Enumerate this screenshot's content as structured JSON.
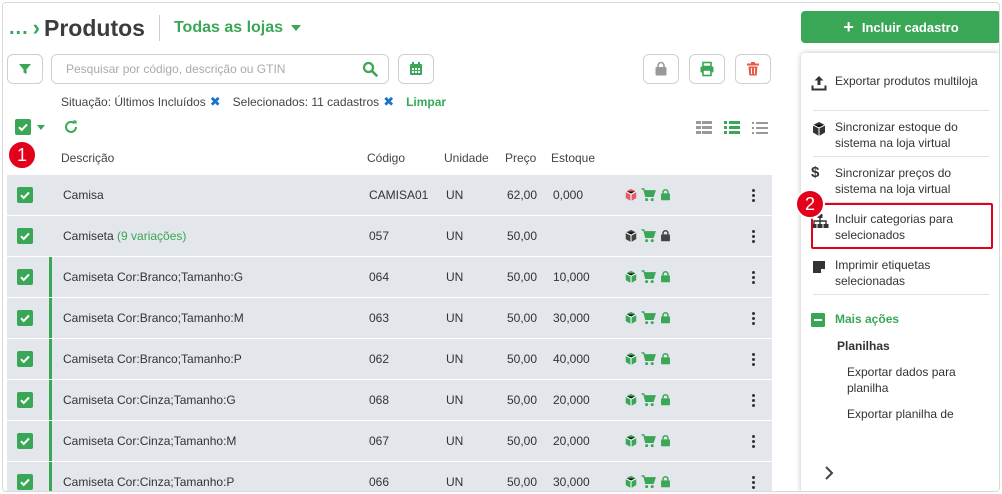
{
  "header": {
    "breadcrumb_dots": "...",
    "title": "Produtos",
    "store_selector": "Todas as lojas"
  },
  "actions": {
    "include_button": "Incluir cadastro"
  },
  "search": {
    "placeholder": "Pesquisar por código, descrição ou GTIN",
    "value": ""
  },
  "filters": {
    "situation": "Situação: Últimos Incluídos",
    "selected": "Selecionados: 11 cadastros",
    "clear": "Limpar"
  },
  "columns": {
    "description": "Descrição",
    "code": "Código",
    "unit": "Unidade",
    "price": "Preço",
    "stock": "Estoque"
  },
  "rows": [
    {
      "description": "Camisa",
      "variations": "",
      "code": "CAMISA01",
      "unit": "UN",
      "price": "62,00",
      "stock": "0,000",
      "type": "parent",
      "box_color": "#e35d6a",
      "bag_color": "#3aa757"
    },
    {
      "description": "Camiseta",
      "variations": "(9 variações)",
      "code": "057",
      "unit": "UN",
      "price": "50,00",
      "stock": "",
      "type": "parent",
      "box_color": "#444444",
      "bag_color": "#444444"
    },
    {
      "description": "Camiseta Cor:Branco;Tamanho:G",
      "variations": "",
      "code": "064",
      "unit": "UN",
      "price": "50,00",
      "stock": "10,000",
      "type": "child",
      "box_color": "#3aa757",
      "bag_color": "#3aa757"
    },
    {
      "description": "Camiseta Cor:Branco;Tamanho:M",
      "variations": "",
      "code": "063",
      "unit": "UN",
      "price": "50,00",
      "stock": "30,000",
      "type": "child",
      "box_color": "#3aa757",
      "bag_color": "#3aa757"
    },
    {
      "description": "Camiseta Cor:Branco;Tamanho:P",
      "variations": "",
      "code": "062",
      "unit": "UN",
      "price": "50,00",
      "stock": "40,000",
      "type": "child",
      "box_color": "#3aa757",
      "bag_color": "#3aa757"
    },
    {
      "description": "Camiseta Cor:Cinza;Tamanho:G",
      "variations": "",
      "code": "068",
      "unit": "UN",
      "price": "50,00",
      "stock": "20,000",
      "type": "child",
      "box_color": "#3aa757",
      "bag_color": "#3aa757"
    },
    {
      "description": "Camiseta Cor:Cinza;Tamanho:M",
      "variations": "",
      "code": "067",
      "unit": "UN",
      "price": "50,00",
      "stock": "20,000",
      "type": "child",
      "box_color": "#3aa757",
      "bag_color": "#3aa757"
    },
    {
      "description": "Camiseta Cor:Cinza;Tamanho:P",
      "variations": "",
      "code": "066",
      "unit": "UN",
      "price": "50,00",
      "stock": "30,000",
      "type": "child",
      "box_color": "#3aa757",
      "bag_color": "#3aa757"
    }
  ],
  "panel": {
    "export_multistore": "Exportar produtos multiloja",
    "sync_stock": "Sincronizar estoque do sistema na loja virtual",
    "sync_prices": "Sincronizar preços do sistema na loja virtual",
    "include_categories": "Incluir categorias para selecionados",
    "print_labels": "Imprimir etiquetas selecionadas",
    "more_actions": "Mais ações",
    "spreadsheets": "Planilhas",
    "export_data": "Exportar dados para planilha",
    "export_sheet": "Exportar planilha de"
  },
  "badges": {
    "first": "1",
    "second": "2"
  },
  "colors": {
    "accent": "#3aa757",
    "danger": "#e3001b",
    "link_blue": "#1a73c9"
  }
}
